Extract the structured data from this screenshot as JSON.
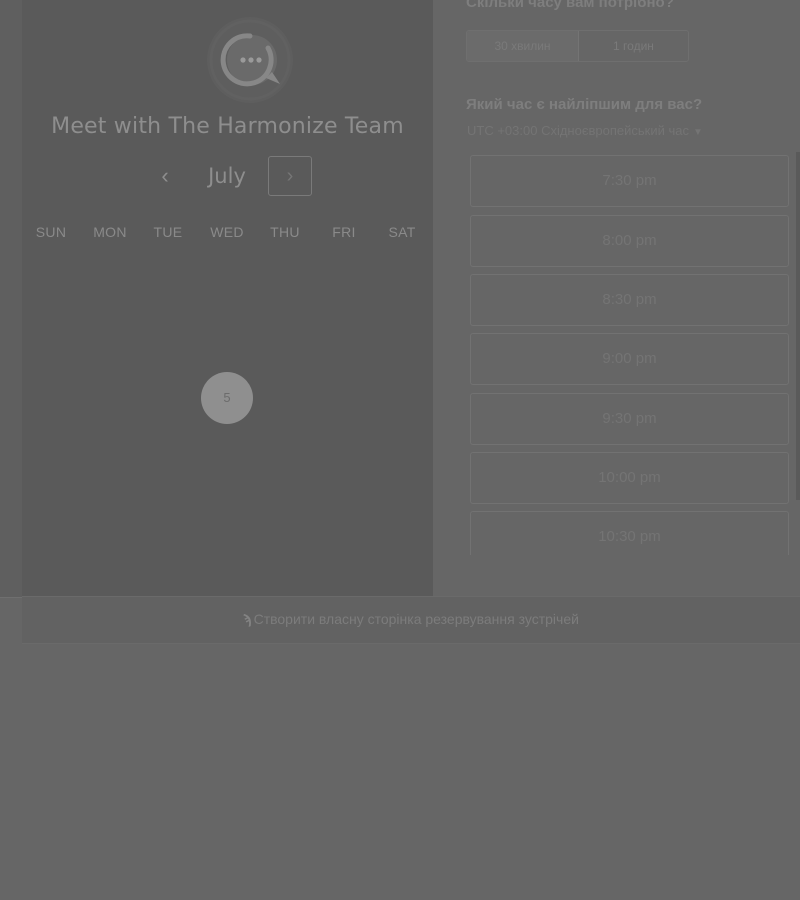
{
  "calendar": {
    "logo_icon": "chat-bubble-icon",
    "title": "Meet with The Harmonize Team",
    "month": "July",
    "prev_symbol": "‹",
    "next_symbol": "›",
    "weekdays": [
      "SUN",
      "MON",
      "TUE",
      "WED",
      "THU",
      "FRI",
      "SAT"
    ],
    "available_day": "5"
  },
  "booking": {
    "duration_heading": "Скільки часу вам потрібно?",
    "duration_options": [
      "30 хвилин",
      "1 годин"
    ],
    "time_heading": "Який час є найліпшим для вас?",
    "timezone": "UTC +03:00 Східноєвропейський час",
    "slots": [
      "7:30 pm",
      "8:00 pm",
      "8:30 pm",
      "9:00 pm",
      "9:30 pm",
      "10:00 pm",
      "10:30 pm"
    ]
  },
  "footer": {
    "icon": "hubspot-sprocket-icon",
    "link_text": "Створити власну сторінка резервування зустрічей"
  }
}
